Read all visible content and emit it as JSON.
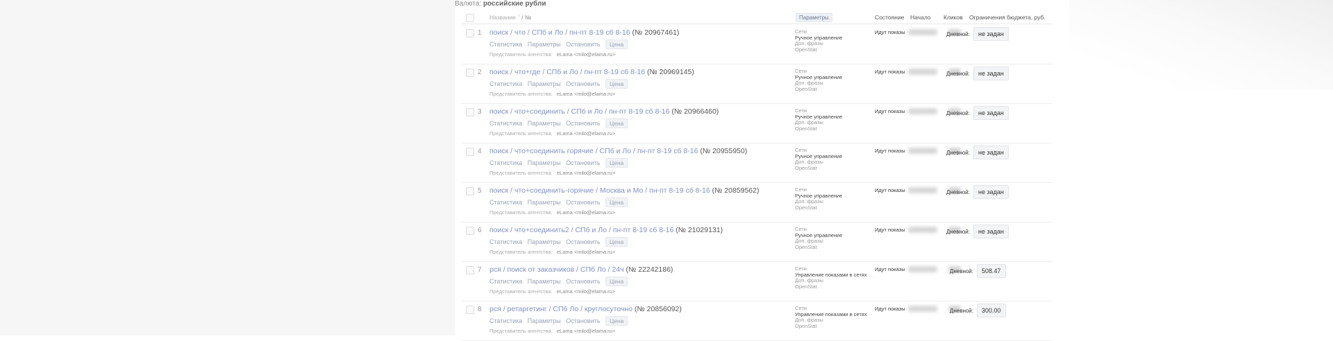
{
  "currency_label": "Валюта:",
  "currency_value": "российские рубли",
  "header": {
    "name": "Название",
    "sort_arrow": "↑",
    "num": "/ №",
    "params": "Параметры",
    "state": "Состояние",
    "start": "Начало",
    "clicks": "Кликов",
    "budget": "Ограничения бюджета, руб."
  },
  "action_labels": {
    "stats": "Статистика",
    "params": "Параметры",
    "stop": "Остановить",
    "price": "Цена"
  },
  "agency_label": "Представитель агентства:",
  "agency_contact": "eLama <milo@elama.ru>",
  "budget_label": "Дневной:",
  "campaigns": [
    {
      "num": "1",
      "name": "поиск / что / СПб и Ло / пн-пт 8-19 сб 8-16",
      "id": "(№ 20967461)",
      "p1": "Сети",
      "p2": "Ручное управление",
      "p3": "Доп. фразы",
      "p4": "OpenStat",
      "state": "Идут показы",
      "budget": "не задан"
    },
    {
      "num": "2",
      "name": "поиск / что+где / СПб и Ло / пн-пт 8-19 сб 8-16",
      "id": "(№ 20969145)",
      "p1": "Сети",
      "p2": "Ручное управление",
      "p3": "Доп. фразы",
      "p4": "OpenStat",
      "state": "Идут показы",
      "budget": "не задан"
    },
    {
      "num": "3",
      "name": "поиск / что+соединить / СПб и Ло / пн-пт 8-19 сб 8-16",
      "id": "(№ 20966460)",
      "p1": "Сети",
      "p2": "Ручное управление",
      "p3": "Доп. фразы",
      "p4": "OpenStat",
      "state": "Идут показы",
      "budget": "не задан"
    },
    {
      "num": "4",
      "name": "поиск / что+соединить горячие / СПб и Ло / пн-пт 8-19 сб 8-16",
      "id": "(№ 20955950)",
      "p1": "Сети",
      "p2": "Ручное управление",
      "p3": "Доп. фразы",
      "p4": "OpenStat",
      "state": "Идут показы",
      "budget": "не задан"
    },
    {
      "num": "5",
      "name": "поиск / что+соединить-горячие / Москва и Мо / пн-пт 8-19 сб 8-16",
      "id": "(№ 20859562)",
      "p1": "Сети",
      "p2": "Ручное управление",
      "p3": "Доп. фразы",
      "p4": "OpenStat",
      "state": "Идут показы",
      "budget": "не задан"
    },
    {
      "num": "6",
      "name": "поиск / что+соединить2 / СПб и Ло / пн-пт 8-19 сб 8-16",
      "id": "(№ 21029131)",
      "p1": "Сети",
      "p2": "Ручное управление",
      "p3": "Доп. фразы",
      "p4": "OpenStat",
      "state": "Идут показы",
      "budget": "не задан"
    },
    {
      "num": "7",
      "name": "рся / поиск от заказчиков / СПб Ло / 24ч",
      "id": "(№ 22242186)",
      "p1": "Сети",
      "p2": "Управление показами в сетях",
      "p3": "Доп. фразы",
      "p4": "OpenStat",
      "state": "Идут показы",
      "budget": "508.47"
    },
    {
      "num": "8",
      "name": "рся / ретаргетинг / СПб Ло / круглосуточно",
      "id": "(№ 20856092)",
      "p1": "Сети",
      "p2": "Управление показами в сетях",
      "p3": "Доп. фразы",
      "p4": "OpenStat",
      "state": "Идут показы",
      "budget": "300.00"
    }
  ]
}
